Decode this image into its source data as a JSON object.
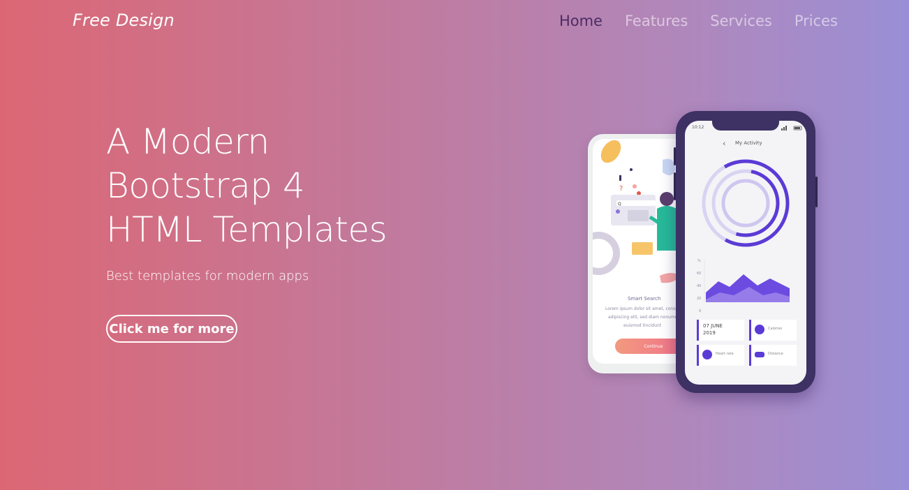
{
  "brand": "Free Design",
  "nav": {
    "items": [
      "Home",
      "Features",
      "Services",
      "Prices"
    ],
    "active": "Home"
  },
  "hero": {
    "title_lines": [
      "A Modern",
      "Bootstrap 4",
      "HTML Templates"
    ],
    "subtitle": "Best templates for modern apps",
    "cta_label": "Click me for more"
  },
  "mockup": {
    "back_phone": {
      "heading": "Smart Search",
      "body_lines": [
        "Lorem ipsum dolor sit amet, consectet",
        "adipiscing elit, sed diam nonummy",
        "euismod tincidunt"
      ],
      "button_label": "Continue"
    },
    "front_phone": {
      "time": "10:12",
      "title": "My Activity",
      "chart_ticks": [
        "%",
        "60",
        "40",
        "20",
        "0"
      ],
      "date_line1": "07 JUNE",
      "date_line2": "2019",
      "card_labels": [
        "Calories",
        "Heart rate",
        "Distance"
      ],
      "accent_color": "#5b3bd6"
    }
  }
}
